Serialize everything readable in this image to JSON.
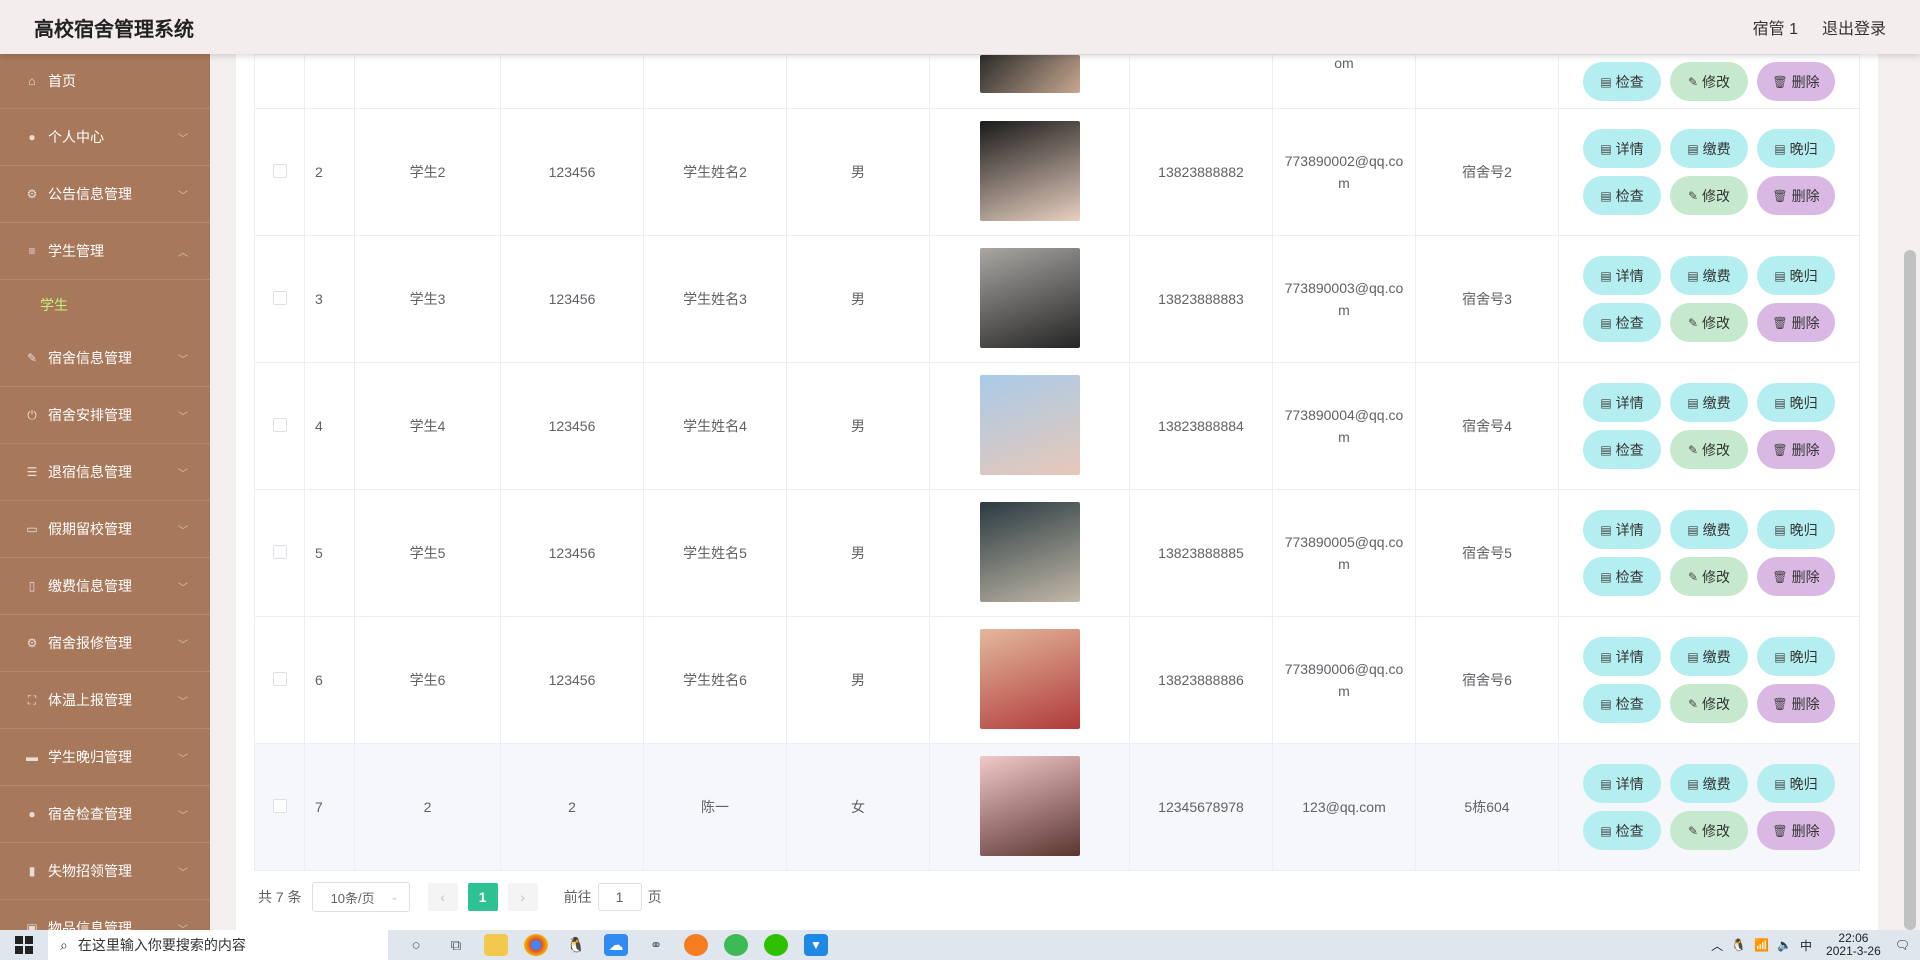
{
  "header": {
    "title": "高校宿舍管理系统",
    "user": "宿管 1",
    "logout": "退出登录"
  },
  "sidebar": {
    "items": [
      {
        "label": "首页",
        "icon": "home-icon"
      },
      {
        "label": "个人中心",
        "icon": "user-icon"
      },
      {
        "label": "公告信息管理",
        "icon": "notice-icon"
      },
      {
        "label": "学生管理",
        "icon": "sliders-icon"
      },
      {
        "label": "宿舍信息管理",
        "icon": "pen-icon"
      },
      {
        "label": "宿舍安排管理",
        "icon": "power-icon"
      },
      {
        "label": "退宿信息管理",
        "icon": "list-icon"
      },
      {
        "label": "假期留校管理",
        "icon": "chat-icon"
      },
      {
        "label": "缴费信息管理",
        "icon": "phone-icon"
      },
      {
        "label": "宿舍报修管理",
        "icon": "gear-icon"
      },
      {
        "label": "体温上报管理",
        "icon": "frame-icon"
      },
      {
        "label": "学生晚归管理",
        "icon": "monitor-icon"
      },
      {
        "label": "宿舍检查管理",
        "icon": "location-icon"
      },
      {
        "label": "失物招领管理",
        "icon": "chart-icon"
      },
      {
        "label": "物品信息管理",
        "icon": "box-icon"
      }
    ],
    "subitem": "学生"
  },
  "table": {
    "top_row": {
      "email_tail": "om"
    },
    "rows": [
      {
        "idx": "2",
        "account": "学生2",
        "password": "123456",
        "name": "学生姓名2",
        "gender": "男",
        "phone": "13823888882",
        "email": "773890002@qq.com",
        "dorm": "宿舍号2",
        "photo": [
          "#1a1a1a",
          "#e8d0c0"
        ]
      },
      {
        "idx": "3",
        "account": "学生3",
        "password": "123456",
        "name": "学生姓名3",
        "gender": "男",
        "phone": "13823888883",
        "email": "773890003@qq.com",
        "dorm": "宿舍号3",
        "photo": [
          "#a9a6a3",
          "#252525"
        ]
      },
      {
        "idx": "4",
        "account": "学生4",
        "password": "123456",
        "name": "学生姓名4",
        "gender": "男",
        "phone": "13823888884",
        "email": "773890004@qq.com",
        "dorm": "宿舍号4",
        "photo": [
          "#a9cbe9",
          "#e7c8b8"
        ]
      },
      {
        "idx": "5",
        "account": "学生5",
        "password": "123456",
        "name": "学生姓名5",
        "gender": "男",
        "phone": "13823888885",
        "email": "773890005@qq.com",
        "dorm": "宿舍号5",
        "photo": [
          "#2a3a40",
          "#c1b8a8"
        ]
      },
      {
        "idx": "6",
        "account": "学生6",
        "password": "123456",
        "name": "学生姓名6",
        "gender": "男",
        "phone": "13823888886",
        "email": "773890006@qq.com",
        "dorm": "宿舍号6",
        "photo": [
          "#e3b89c",
          "#b03a3a"
        ]
      },
      {
        "idx": "7",
        "account": "2",
        "password": "2",
        "name": "陈一",
        "gender": "女",
        "phone": "12345678978",
        "email": "123@qq.com",
        "dorm": "5栋604",
        "photo": [
          "#f2c9c9",
          "#5a3530"
        ]
      }
    ],
    "buttons": {
      "detail": "详情",
      "pay": "缴费",
      "late": "晚归",
      "check": "检查",
      "edit": "修改",
      "delete": "删除"
    }
  },
  "pagination": {
    "total": "共 7 条",
    "page_size": "10条/页",
    "current": "1",
    "goto_prefix": "前往",
    "goto_value": "1",
    "goto_suffix": "页"
  },
  "taskbar": {
    "search_placeholder": "在这里输入你要搜索的内容",
    "time": "22:06",
    "date": "2021-3-26"
  },
  "colors": {
    "sidebar": "#a8785a",
    "header": "#f4eded",
    "active_sub": "#c8f07a",
    "btn_cyan": "#b5eef0",
    "btn_green": "#c6e8cc",
    "btn_purple": "#d9b8e4",
    "page_active": "#2ec194"
  }
}
